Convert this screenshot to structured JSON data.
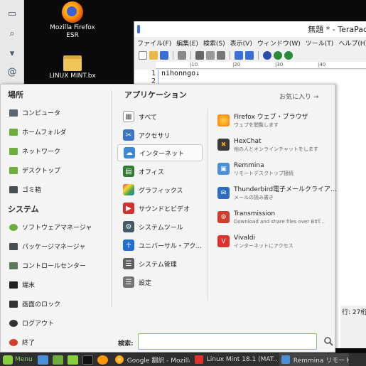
{
  "desktop": {
    "icons": [
      {
        "label_line1": "Mozilla Firefox",
        "label_line2": "ESR",
        "icon": "firefox-icon"
      },
      {
        "label_line1": "LINUX MINT.bx",
        "label_line2": "",
        "icon": "folder-icon"
      }
    ]
  },
  "terapad": {
    "title": "無題 * - TeraPad",
    "menu": [
      "ファイル(F)",
      "編集(E)",
      "検索(S)",
      "表示(V)",
      "ウィンドウ(W)",
      "ツール(T)",
      "ヘルプ(H)"
    ],
    "ruler": [
      "|10",
      "|20",
      "|30",
      "|40"
    ],
    "line_numbers": [
      "1",
      "2"
    ],
    "text": "nihonngo↓",
    "status": "行: 27桁"
  },
  "menu": {
    "places_title": "場所",
    "places": [
      {
        "label": "コンピュータ",
        "icon": "computer-icon"
      },
      {
        "label": "ホームフォルダ",
        "icon": "home-folder-icon"
      },
      {
        "label": "ネットワーク",
        "icon": "network-icon"
      },
      {
        "label": "デスクトップ",
        "icon": "desktop-icon"
      },
      {
        "label": "ゴミ箱",
        "icon": "trash-icon"
      }
    ],
    "system_title": "システム",
    "system": [
      {
        "label": "ソフトウェアマネージャ",
        "icon": "software-manager-icon"
      },
      {
        "label": "パッケージマネージャ",
        "icon": "package-manager-icon"
      },
      {
        "label": "コントロールセンター",
        "icon": "control-center-icon"
      },
      {
        "label": "端末",
        "icon": "terminal-icon"
      },
      {
        "label": "画面のロック",
        "icon": "lock-icon"
      },
      {
        "label": "ログアウト",
        "icon": "logout-icon"
      },
      {
        "label": "終了",
        "icon": "power-icon"
      }
    ],
    "apps_title": "アプリケーション",
    "favorites_label": "お気に入り →",
    "categories": [
      {
        "label": "すべて",
        "icon": "all-apps-icon"
      },
      {
        "label": "アクセサリ",
        "icon": "accessories-icon"
      },
      {
        "label": "インターネット",
        "icon": "internet-icon"
      },
      {
        "label": "オフィス",
        "icon": "office-icon"
      },
      {
        "label": "グラフィックス",
        "icon": "graphics-icon"
      },
      {
        "label": "サウンドとビデオ",
        "icon": "sound-video-icon"
      },
      {
        "label": "システムツール",
        "icon": "system-tools-icon"
      },
      {
        "label": "ユニバーサル・アク...",
        "icon": "universal-access-icon"
      },
      {
        "label": "システム管理",
        "icon": "administration-icon"
      },
      {
        "label": "設定",
        "icon": "preferences-icon"
      }
    ],
    "selected_category": "インターネット",
    "apps": [
      {
        "name": "Firefox ウェブ・ブラウザ",
        "desc": "ウェブを閲覧します",
        "icon": "firefox-icon"
      },
      {
        "name": "HexChat",
        "desc": "他の人とオンラインチャットをします",
        "icon": "hexchat-icon"
      },
      {
        "name": "Remmina",
        "desc": "リモートデスクトップ接続",
        "icon": "remmina-icon"
      },
      {
        "name": "Thunderbird電子メールクライア...",
        "desc": "メールの読み書き",
        "icon": "thunderbird-icon"
      },
      {
        "name": "Transmission",
        "desc": "Download and share files over BitT...",
        "icon": "transmission-icon"
      },
      {
        "name": "Vivaldi",
        "desc": "インターネットにアクセス",
        "icon": "vivaldi-icon"
      }
    ],
    "search_label": "検索:",
    "search_value": ""
  },
  "panel": {
    "menu_label": "Menu",
    "tasks": [
      {
        "label": "Google 翻訳 - Mozilla ...",
        "icon": "firefox-icon"
      },
      {
        "label": "Linux Mint 18.1 (MAT...",
        "icon": "vivaldi-icon"
      },
      {
        "label": "Remmina リモートデ",
        "icon": "remmina-icon"
      }
    ]
  },
  "colors": {
    "accent": "#87cf3e",
    "panel_bg": "#2f2f2f",
    "menu_bg": "#f4f4f4"
  }
}
